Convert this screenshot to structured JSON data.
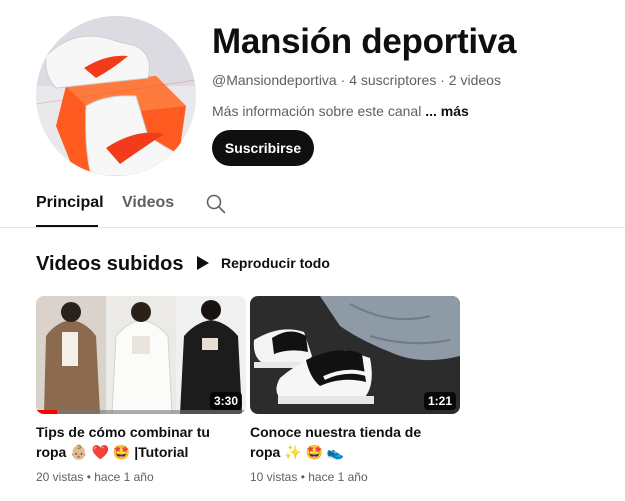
{
  "channel": {
    "name": "Mansión deportiva",
    "handle": "@Mansiondeportiva",
    "subscribers": "4 suscriptores",
    "video_count": "2 videos",
    "meta_separator": " · ",
    "description": "Más información sobre este canal",
    "more_label": "... más",
    "subscribe_label": "Suscribirse"
  },
  "tabs": {
    "principal": "Principal",
    "videos": "Videos",
    "search_icon": "search-icon"
  },
  "section": {
    "title": "Videos subidos",
    "play_all_label": "Reproducir todo",
    "play_icon": "play-icon"
  },
  "videos": [
    {
      "title": "Tips de cómo combinar tu ropa 👶🏼 ❤️ 🤩 |Tutorial",
      "duration": "3:30",
      "views": "20 vistas",
      "age": "hace 1 año",
      "watched_fraction": 0.1
    },
    {
      "title": "Conoce nuestra tienda de ropa ✨ 🤩 👟",
      "duration": "1:21",
      "views": "10 vistas",
      "age": "hace 1 año"
    }
  ],
  "colors": {
    "accent": "#ff0000",
    "button_bg": "#0f0f0f",
    "text_secondary": "#606060"
  }
}
